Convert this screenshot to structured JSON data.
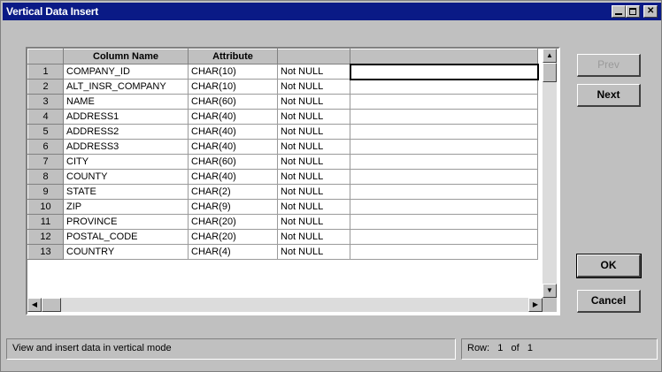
{
  "window": {
    "title": "Vertical Data Insert"
  },
  "grid": {
    "headers": {
      "rownum": "",
      "column_name": "Column Name",
      "attribute": "Attribute",
      "constraint": "",
      "value": ""
    },
    "rows": [
      {
        "n": "1",
        "name": "COMPANY_ID",
        "attr": "CHAR(10)",
        "constraint": "Not NULL",
        "value": ""
      },
      {
        "n": "2",
        "name": "ALT_INSR_COMPANY",
        "attr": "CHAR(10)",
        "constraint": "Not NULL",
        "value": ""
      },
      {
        "n": "3",
        "name": "NAME",
        "attr": "CHAR(60)",
        "constraint": "Not NULL",
        "value": ""
      },
      {
        "n": "4",
        "name": "ADDRESS1",
        "attr": "CHAR(40)",
        "constraint": "Not NULL",
        "value": ""
      },
      {
        "n": "5",
        "name": "ADDRESS2",
        "attr": "CHAR(40)",
        "constraint": "Not NULL",
        "value": ""
      },
      {
        "n": "6",
        "name": "ADDRESS3",
        "attr": "CHAR(40)",
        "constraint": "Not NULL",
        "value": ""
      },
      {
        "n": "7",
        "name": "CITY",
        "attr": "CHAR(60)",
        "constraint": "Not NULL",
        "value": ""
      },
      {
        "n": "8",
        "name": "COUNTY",
        "attr": "CHAR(40)",
        "constraint": "Not NULL",
        "value": ""
      },
      {
        "n": "9",
        "name": "STATE",
        "attr": "CHAR(2)",
        "constraint": "Not NULL",
        "value": ""
      },
      {
        "n": "10",
        "name": "ZIP",
        "attr": "CHAR(9)",
        "constraint": "Not NULL",
        "value": ""
      },
      {
        "n": "11",
        "name": "PROVINCE",
        "attr": "CHAR(20)",
        "constraint": "Not NULL",
        "value": ""
      },
      {
        "n": "12",
        "name": "POSTAL_CODE",
        "attr": "CHAR(20)",
        "constraint": "Not NULL",
        "value": ""
      },
      {
        "n": "13",
        "name": "COUNTRY",
        "attr": "CHAR(4)",
        "constraint": "Not NULL",
        "value": ""
      }
    ]
  },
  "buttons": {
    "prev": "Prev",
    "next": "Next",
    "ok": "OK",
    "cancel": "Cancel"
  },
  "status": {
    "message": "View and insert data in vertical mode",
    "row_label": "Row:",
    "row_current": "1",
    "row_of": "of",
    "row_total": "1"
  },
  "icons": {
    "minimize": "minimize-icon",
    "maximize": "maximize-icon",
    "close": "close-icon"
  }
}
